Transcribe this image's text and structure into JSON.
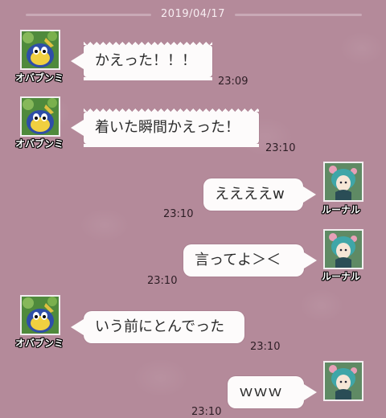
{
  "date": "2019/04/17",
  "users": {
    "obabunmi": "オバブンミ",
    "ruunaru": "ルーナル"
  },
  "messages": [
    {
      "sender": "obabunmi",
      "text": "かえった！！！",
      "time": "23:09",
      "style": "spiky"
    },
    {
      "sender": "obabunmi",
      "text": "着いた瞬間かえった！",
      "time": "23:10",
      "style": "spiky"
    },
    {
      "sender": "ruunaru",
      "text": "ええええw",
      "time": "23:10",
      "style": "normal"
    },
    {
      "sender": "ruunaru",
      "text": "言ってよ＞＜",
      "time": "23:10",
      "style": "normal"
    },
    {
      "sender": "obabunmi",
      "text": "いう前にとんでった",
      "time": "23:10",
      "style": "normal"
    },
    {
      "sender": "ruunaru",
      "text": "ｗｗｗ",
      "time": "23:10",
      "style": "normal"
    }
  ]
}
